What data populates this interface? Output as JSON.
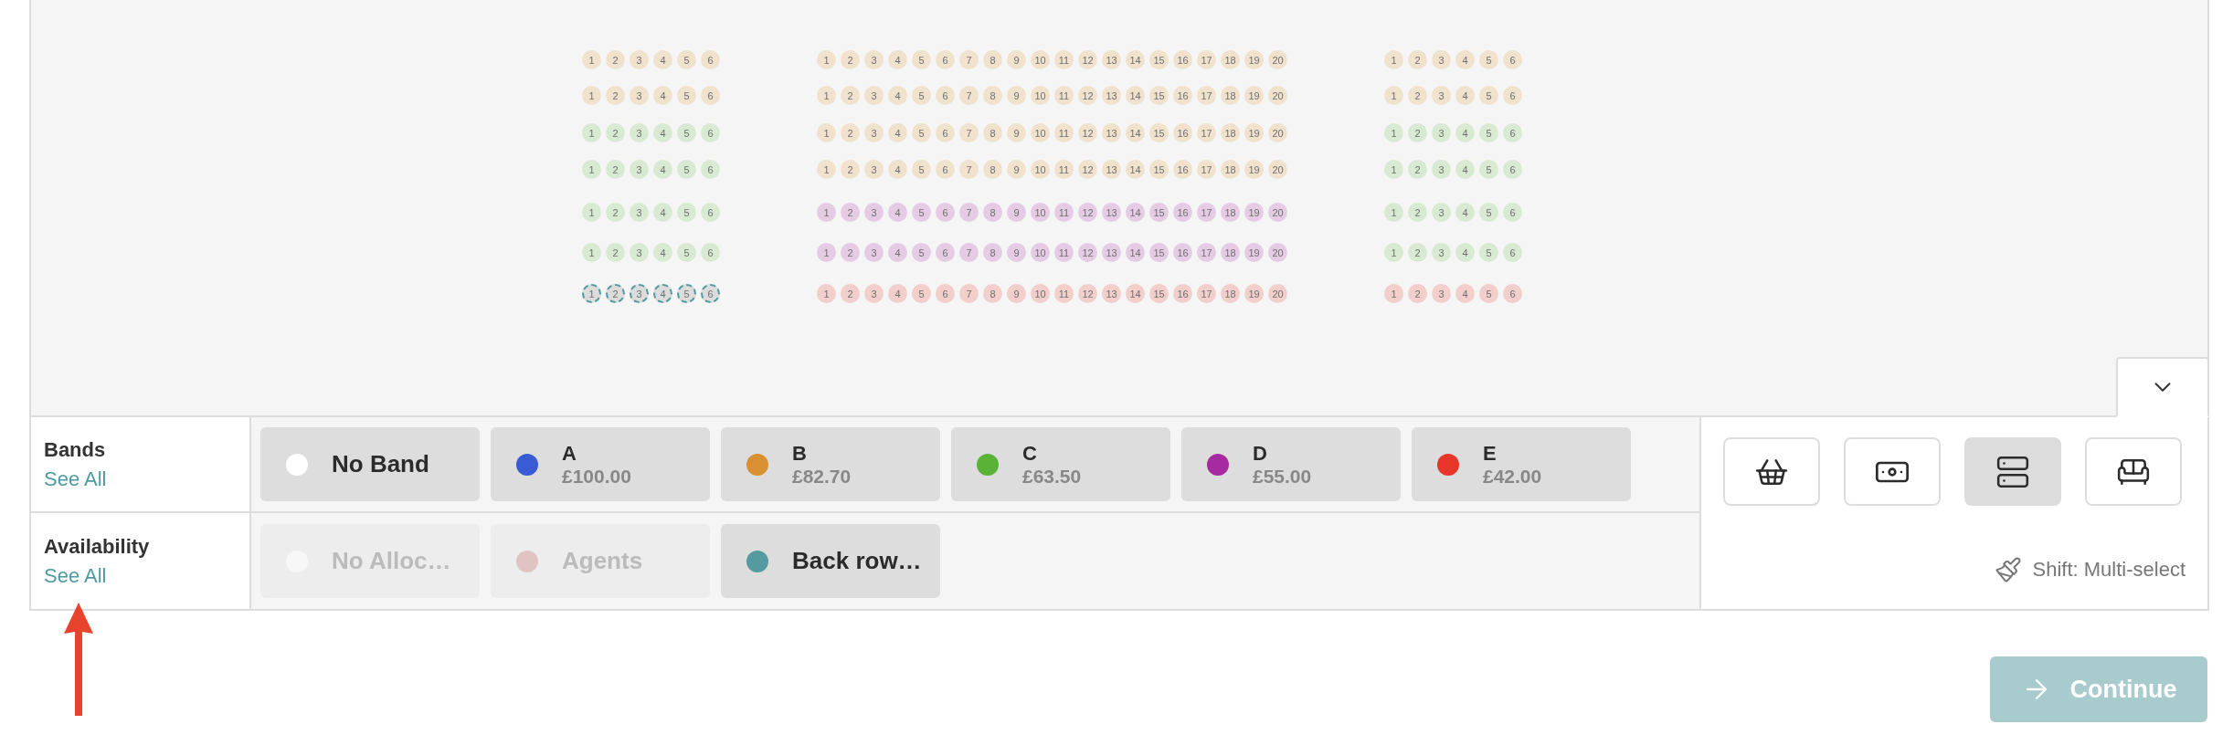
{
  "seat_map": {
    "blocks": [
      {
        "rows": [
          {
            "color": "#f0e2cd",
            "selected": false,
            "seats": [
              "1",
              "2",
              "3",
              "4",
              "5",
              "6"
            ]
          },
          {
            "color": "#f0e2cd",
            "selected": false,
            "seats": [
              "1",
              "2",
              "3",
              "4",
              "5",
              "6"
            ]
          },
          {
            "color": "#d9ead3",
            "selected": false,
            "seats": [
              "1",
              "2",
              "3",
              "4",
              "5",
              "6"
            ]
          },
          {
            "color": "#d9ead3",
            "selected": false,
            "seats": [
              "1",
              "2",
              "3",
              "4",
              "5",
              "6"
            ]
          },
          {
            "color": "#d9ead3",
            "selected": false,
            "seats": [
              "1",
              "2",
              "3",
              "4",
              "5",
              "6"
            ]
          },
          {
            "color": "#d9ead3",
            "selected": false,
            "seats": [
              "1",
              "2",
              "3",
              "4",
              "5",
              "6"
            ]
          },
          {
            "color": "#dcdcdc",
            "selected": true,
            "seats": [
              "1",
              "2",
              "3",
              "4",
              "5",
              "6"
            ]
          }
        ]
      },
      {
        "rows": [
          {
            "color": "#f0e2cd",
            "selected": false,
            "seats": [
              "1",
              "2",
              "3",
              "4",
              "5",
              "6",
              "7",
              "8",
              "9",
              "10",
              "11",
              "12",
              "13",
              "14",
              "15",
              "16",
              "17",
              "18",
              "19",
              "20"
            ]
          },
          {
            "color": "#f0e2cd",
            "selected": false,
            "seats": [
              "1",
              "2",
              "3",
              "4",
              "5",
              "6",
              "7",
              "8",
              "9",
              "10",
              "11",
              "12",
              "13",
              "14",
              "15",
              "16",
              "17",
              "18",
              "19",
              "20"
            ]
          },
          {
            "color": "#f0e2cd",
            "selected": false,
            "seats": [
              "1",
              "2",
              "3",
              "4",
              "5",
              "6",
              "7",
              "8",
              "9",
              "10",
              "11",
              "12",
              "13",
              "14",
              "15",
              "16",
              "17",
              "18",
              "19",
              "20"
            ]
          },
          {
            "color": "#f0e2cd",
            "selected": false,
            "seats": [
              "1",
              "2",
              "3",
              "4",
              "5",
              "6",
              "7",
              "8",
              "9",
              "10",
              "11",
              "12",
              "13",
              "14",
              "15",
              "16",
              "17",
              "18",
              "19",
              "20"
            ]
          },
          {
            "color": "#e5cce4",
            "selected": false,
            "seats": [
              "1",
              "2",
              "3",
              "4",
              "5",
              "6",
              "7",
              "8",
              "9",
              "10",
              "11",
              "12",
              "13",
              "14",
              "15",
              "16",
              "17",
              "18",
              "19",
              "20"
            ]
          },
          {
            "color": "#e5cce4",
            "selected": false,
            "seats": [
              "1",
              "2",
              "3",
              "4",
              "5",
              "6",
              "7",
              "8",
              "9",
              "10",
              "11",
              "12",
              "13",
              "14",
              "15",
              "16",
              "17",
              "18",
              "19",
              "20"
            ]
          },
          {
            "color": "#f2cfcb",
            "selected": false,
            "seats": [
              "1",
              "2",
              "3",
              "4",
              "5",
              "6",
              "7",
              "8",
              "9",
              "10",
              "11",
              "12",
              "13",
              "14",
              "15",
              "16",
              "17",
              "18",
              "19",
              "20"
            ]
          }
        ]
      },
      {
        "rows": [
          {
            "color": "#f0e2cd",
            "selected": false,
            "seats": [
              "1",
              "2",
              "3",
              "4",
              "5",
              "6"
            ]
          },
          {
            "color": "#f0e2cd",
            "selected": false,
            "seats": [
              "1",
              "2",
              "3",
              "4",
              "5",
              "6"
            ]
          },
          {
            "color": "#d9ead3",
            "selected": false,
            "seats": [
              "1",
              "2",
              "3",
              "4",
              "5",
              "6"
            ]
          },
          {
            "color": "#d9ead3",
            "selected": false,
            "seats": [
              "1",
              "2",
              "3",
              "4",
              "5",
              "6"
            ]
          },
          {
            "color": "#d9ead3",
            "selected": false,
            "seats": [
              "1",
              "2",
              "3",
              "4",
              "5",
              "6"
            ]
          },
          {
            "color": "#d9ead3",
            "selected": false,
            "seats": [
              "1",
              "2",
              "3",
              "4",
              "5",
              "6"
            ]
          },
          {
            "color": "#f2cfcb",
            "selected": false,
            "seats": [
              "1",
              "2",
              "3",
              "4",
              "5",
              "6"
            ]
          }
        ]
      }
    ]
  },
  "filters": [
    {
      "title": "Bands",
      "link": "See All",
      "chips": [
        {
          "label": "No Band",
          "color": "#ffffff",
          "disabled": false
        },
        {
          "label": "A",
          "price": "£100.00",
          "color": "#3a5bd6",
          "disabled": false
        },
        {
          "label": "B",
          "price": "£82.70",
          "color": "#d89032",
          "disabled": false
        },
        {
          "label": "C",
          "price": "£63.50",
          "color": "#5ab237",
          "disabled": false
        },
        {
          "label": "D",
          "price": "£55.00",
          "color": "#a62aa0",
          "disabled": false
        },
        {
          "label": "E",
          "price": "£42.00",
          "color": "#e8362a",
          "disabled": false
        }
      ]
    },
    {
      "title": "Availability",
      "link": "See All",
      "chips": [
        {
          "label": "No Alloc…",
          "color": "#f7f7f7",
          "disabled": true
        },
        {
          "label": "Agents",
          "color": "#e0c4c4",
          "disabled": true
        },
        {
          "label": "Back row…",
          "color": "#549ba0",
          "disabled": false
        }
      ]
    }
  ],
  "tools": [
    {
      "kind": "basket",
      "selected": false
    },
    {
      "kind": "money",
      "selected": false
    },
    {
      "kind": "rows",
      "selected": true
    },
    {
      "kind": "sofa",
      "selected": false
    }
  ],
  "hint": "Shift: Multi-select",
  "continue_button": "Continue"
}
